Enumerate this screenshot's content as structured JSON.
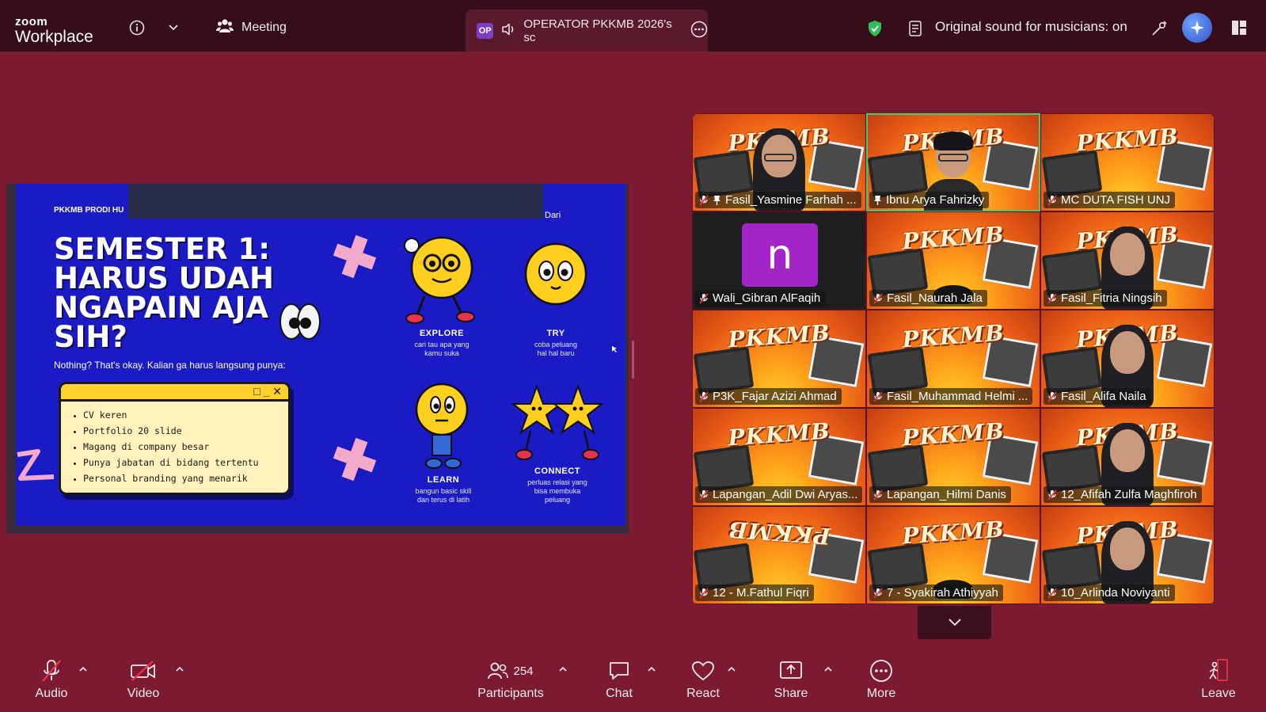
{
  "app": {
    "logo_line1": "zoom",
    "logo_line2": "Workplace"
  },
  "topbar": {
    "meeting_label": "Meeting",
    "share_badge": "OP",
    "share_title": "OPERATOR PKKMB 2026's sc",
    "sound_label": "Original sound for musicians: on"
  },
  "slide": {
    "top_left": "PKKMB PRODI HU",
    "top_right": "Dari",
    "title_lines": [
      "SEMESTER 1:",
      "HARUS UDAH",
      "NGAPAIN AJA",
      "SIH?"
    ],
    "subtitle": "Nothing? That's okay. Kalian ga harus langsung punya:",
    "window_controls": "□ _ ✕",
    "list": [
      "CV keren",
      "Portfolio 20 slide",
      "Magang di company besar",
      "Punya jabatan di bidang tertentu",
      "Personal branding yang menarik"
    ],
    "characters": [
      {
        "label": "EXPLORE",
        "desc1": "cari tau apa yang",
        "desc2": "kamu suka"
      },
      {
        "label": "TRY",
        "desc1": "coba peluang",
        "desc2": "hal hal baru"
      },
      {
        "label": "LEARN",
        "desc1": "bangun basic skill",
        "desc2": "dan terus di latih"
      },
      {
        "label": "CONNECT",
        "desc1": "perluas relasi yang",
        "desc2": "bisa membuka",
        "desc3": "peluang"
      }
    ]
  },
  "gallery": {
    "poster_text": "PKKMB",
    "avatar_letter": "n",
    "tiles": [
      {
        "name": "Fasil_Yasmine Farhah ..."
      },
      {
        "name": "Ibnu Arya Fahrizky"
      },
      {
        "name": "MC DUTA FISH UNJ"
      },
      {
        "name": "Wali_Gibran AlFaqih"
      },
      {
        "name": "Fasil_Naurah Jala"
      },
      {
        "name": "Fasil_Fitria Ningsih"
      },
      {
        "name": "P3K_Fajar Azizi Ahmad"
      },
      {
        "name": "Fasil_Muhammad Helmi ..."
      },
      {
        "name": "Fasil_Alifa Naila"
      },
      {
        "name": "Lapangan_Adil Dwi Aryas..."
      },
      {
        "name": "Lapangan_Hilmi Danis"
      },
      {
        "name": "12_Afifah Zulfa Maghfiroh"
      },
      {
        "name": "12 - M.Fathul Fiqri"
      },
      {
        "name": "7 - Syakirah Athiyyah"
      },
      {
        "name": "10_Arlinda Noviyanti"
      }
    ]
  },
  "toolbar": {
    "audio": "Audio",
    "video": "Video",
    "participants": "Participants",
    "participants_count": "254",
    "chat": "Chat",
    "react": "React",
    "share": "Share",
    "more": "More",
    "leave": "Leave"
  },
  "colors": {
    "background": "#7b1a31",
    "topbar": "#350e1a",
    "active_speaker": "#3cd06a",
    "slide_bg": "#1b1bc6",
    "muted_red": "#e8334a"
  }
}
